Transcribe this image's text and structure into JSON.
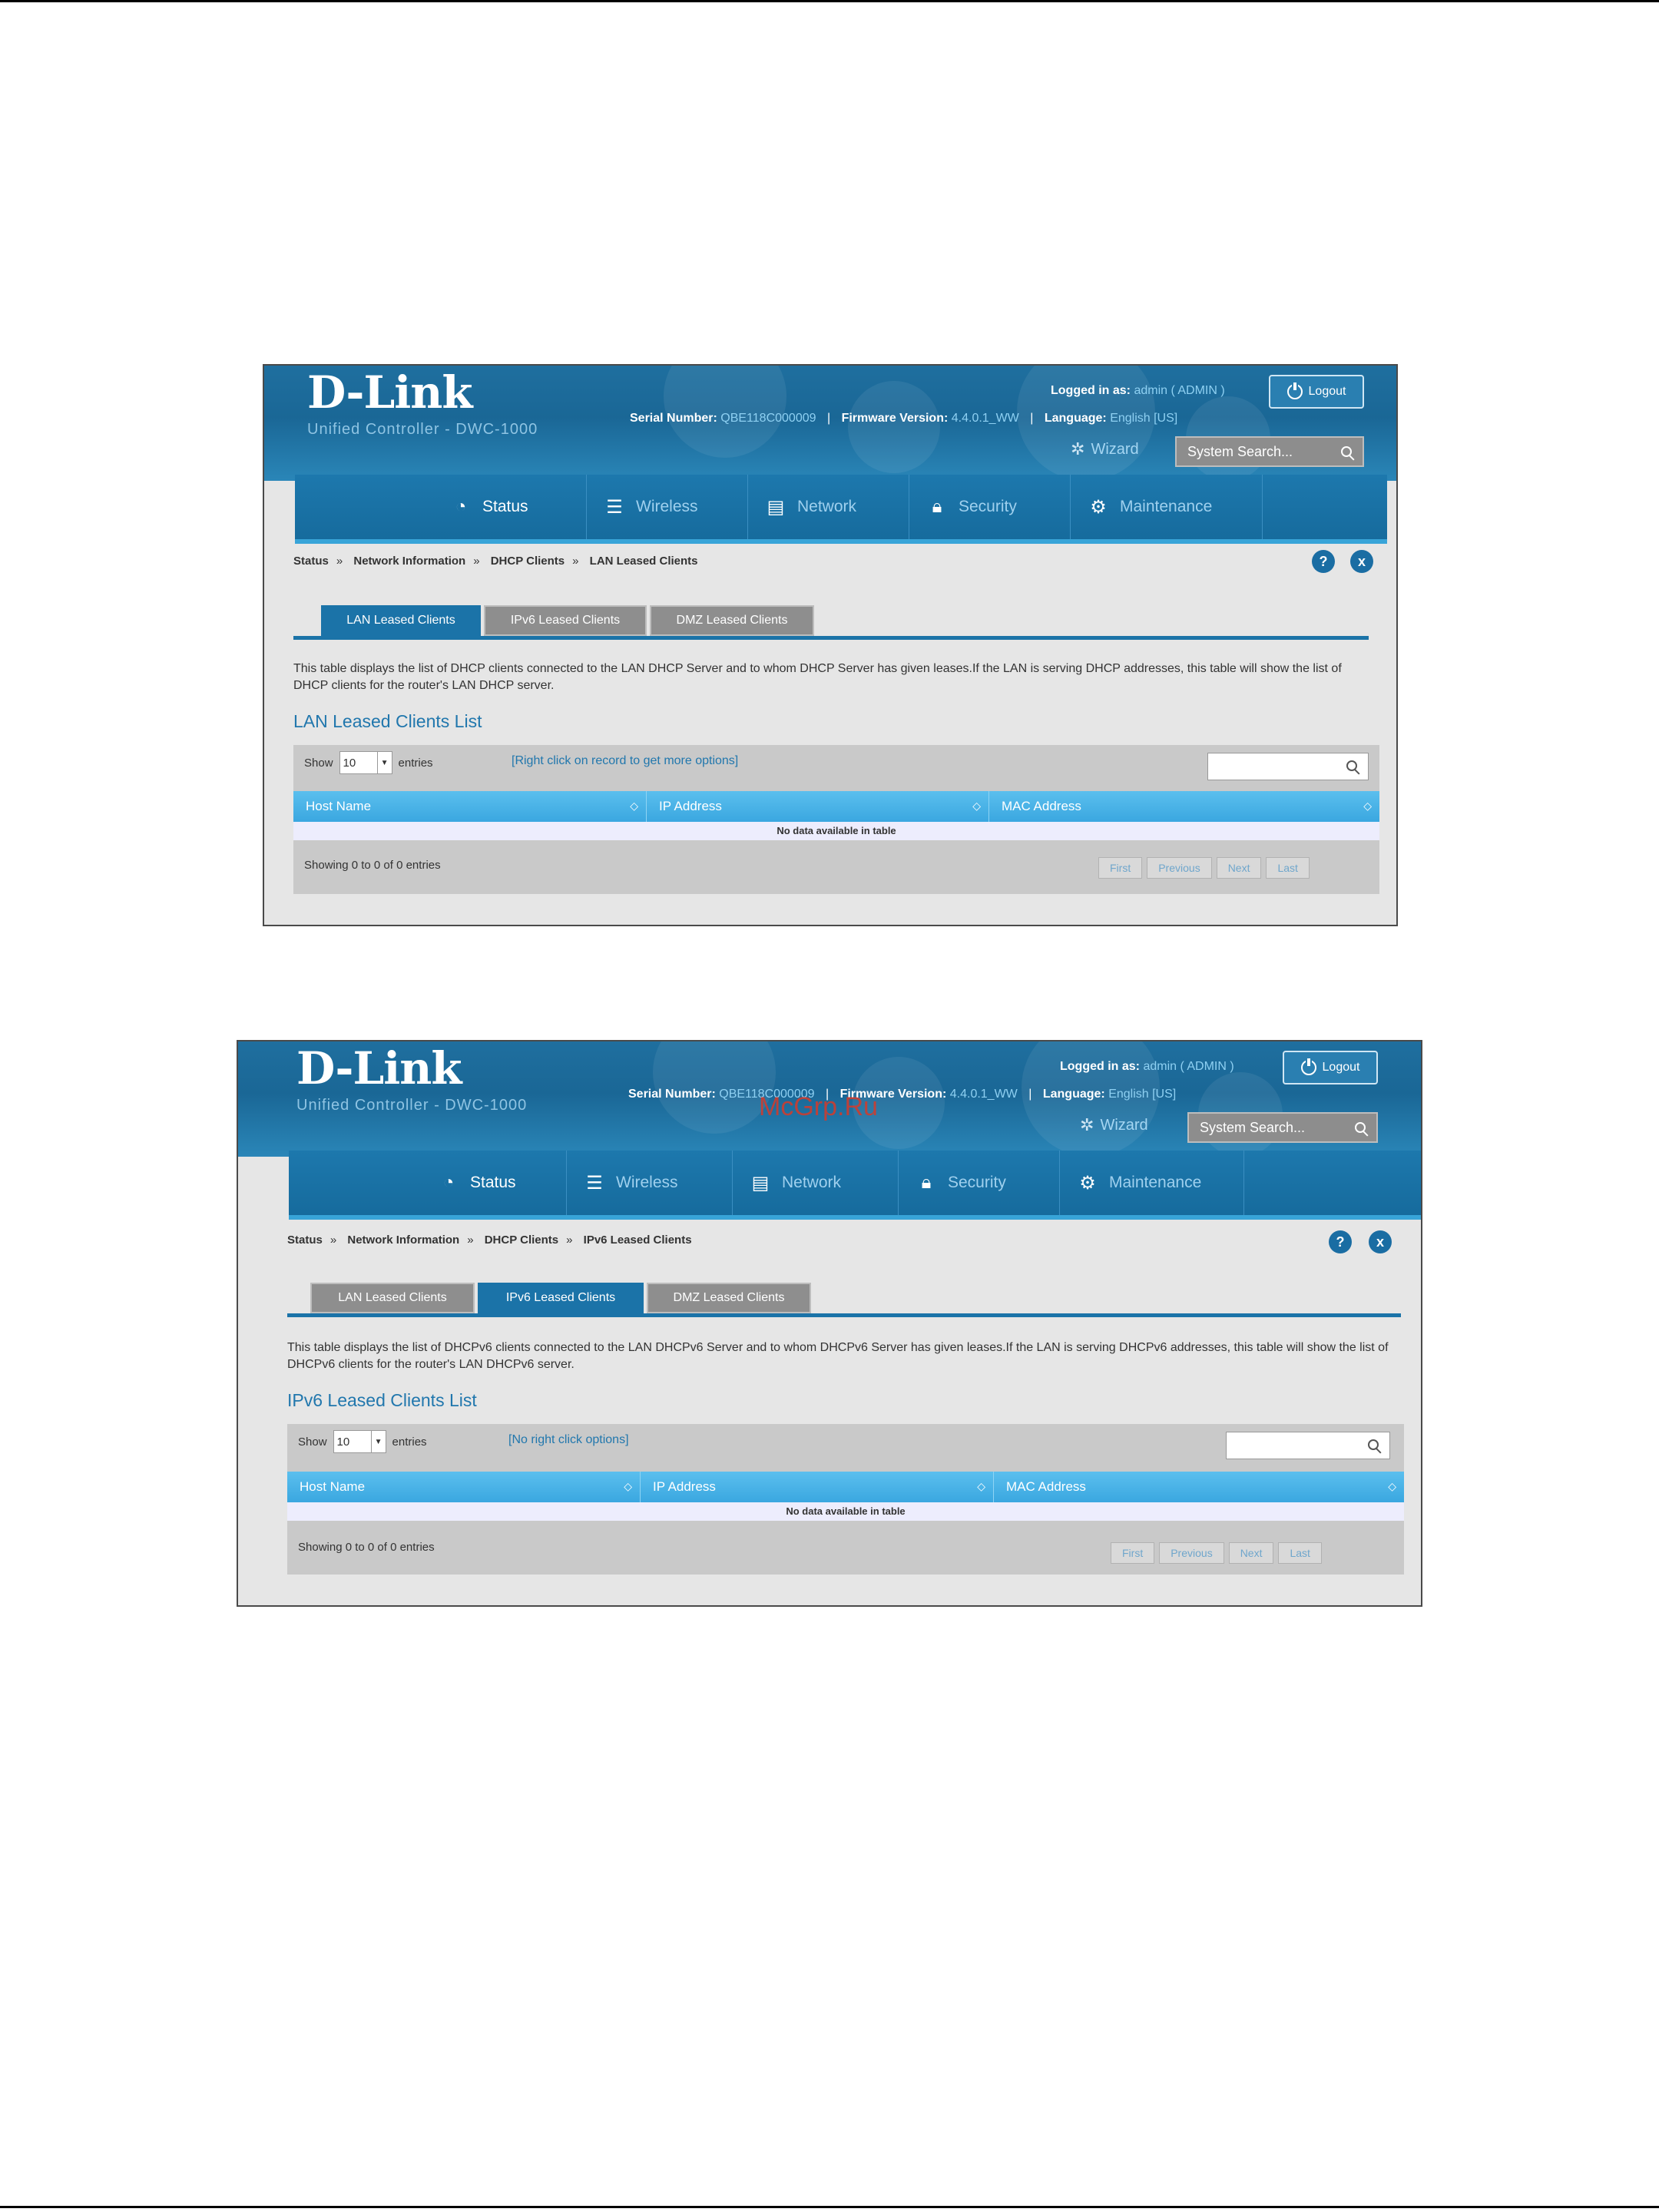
{
  "common": {
    "logo": "D-Link",
    "logo_sub": "Unified Controller - DWC-1000",
    "logged_in_label": "Logged in as:",
    "logged_in_user": "admin ( ADMIN )",
    "logout_label": "Logout",
    "serial_label": "Serial Number:",
    "serial_value": "QBE118C000009",
    "firmware_label": "Firmware Version:",
    "firmware_value": "4.4.0.1_WW",
    "language_label": "Language:",
    "language_value": "English [US]",
    "wizard_label": "Wizard",
    "system_search": "System Search...",
    "nav": [
      "Status",
      "Wireless",
      "Network",
      "Security",
      "Maintenance"
    ],
    "tabs": [
      "LAN Leased Clients",
      "IPv6 Leased Clients",
      "DMZ Leased Clients"
    ],
    "show_label": "Show",
    "show_value": "10",
    "entries_label": "entries",
    "columns": [
      "Host Name",
      "IP Address",
      "MAC Address"
    ],
    "no_data": "No data available in table",
    "showing": "Showing 0 to 0 of 0 entries",
    "pager": [
      "First",
      "Previous",
      "Next",
      "Last"
    ],
    "help_icon": "?",
    "close_icon": "x"
  },
  "screen1": {
    "breadcrumb": [
      "Status",
      "Network Information",
      "DHCP Clients",
      "LAN Leased Clients"
    ],
    "description": "This table displays the list of DHCP clients connected to the LAN DHCP Server and to whom DHCP Server has given leases.If the LAN is serving DHCP addresses, this table will show the list of DHCP clients for the router's LAN DHCP server.",
    "list_title": "LAN Leased Clients List",
    "hint": "[Right click on record to get more options]"
  },
  "screen2": {
    "breadcrumb": [
      "Status",
      "Network Information",
      "DHCP Clients",
      "IPv6 Leased Clients"
    ],
    "description": "This table displays the list of DHCPv6 clients connected to the LAN DHCPv6 Server and to whom DHCPv6 Server has given leases.If the LAN is serving DHCPv6 addresses, this table will show the list of DHCPv6 clients for the router's LAN DHCPv6 server.",
    "list_title": "IPv6 Leased Clients List",
    "hint": "[No right click options]"
  },
  "watermark": "McGrp.Ru"
}
